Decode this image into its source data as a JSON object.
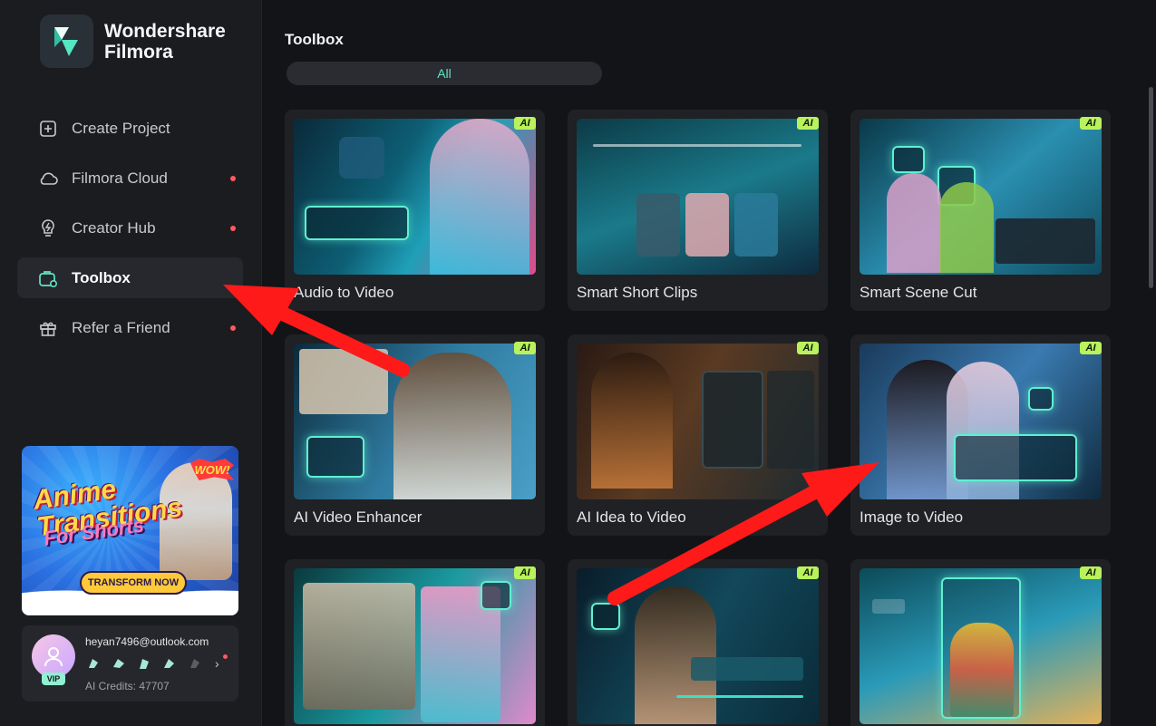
{
  "app": {
    "brand_line1": "Wondershare",
    "brand_line2": "Filmora"
  },
  "sidebar": {
    "items": [
      {
        "label": "Create Project",
        "icon": "plus-square-icon",
        "dot": false,
        "active": false
      },
      {
        "label": "Filmora Cloud",
        "icon": "cloud-icon",
        "dot": true,
        "active": false
      },
      {
        "label": "Creator Hub",
        "icon": "bulb-icon",
        "dot": true,
        "active": false
      },
      {
        "label": "Toolbox",
        "icon": "toolbox-icon",
        "dot": false,
        "active": true
      },
      {
        "label": "Refer a Friend",
        "icon": "gift-icon",
        "dot": true,
        "active": false
      }
    ],
    "promo": {
      "line1": "Anime Transitions",
      "line2": "For Shorts",
      "wow": "WOW!",
      "cta": "TRANSFORM NOW"
    },
    "account": {
      "email": "heyan7496@outlook.com",
      "vip": "VIP",
      "credits": "AI Credits: 47707"
    }
  },
  "main": {
    "title": "Toolbox",
    "filter": "All",
    "ai_tag": "AI",
    "cards": [
      {
        "label": "Audio to Video"
      },
      {
        "label": "Smart Short Clips"
      },
      {
        "label": "Smart Scene Cut"
      },
      {
        "label": "AI Video Enhancer"
      },
      {
        "label": "AI Idea to Video"
      },
      {
        "label": "Image to Video"
      },
      {
        "label": ""
      },
      {
        "label": ""
      },
      {
        "label": ""
      }
    ]
  },
  "colors": {
    "accent": "#63e3c3",
    "ai_tag": "#b9f25c",
    "notification_dot": "#ff5a5f",
    "annotation_arrow": "#ff1a1a"
  }
}
